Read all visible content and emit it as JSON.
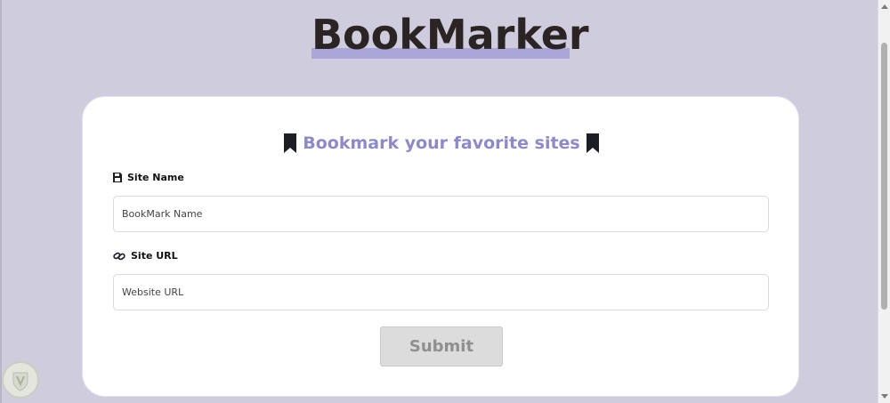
{
  "app": {
    "logo_text": "BookMarker"
  },
  "form": {
    "heading": "Bookmark your favorite sites",
    "site_name": {
      "label": "Site Name",
      "placeholder": "BookMark Name",
      "value": ""
    },
    "site_url": {
      "label": "Site URL",
      "placeholder": "Website URL",
      "value": ""
    },
    "submit_label": "Submit"
  },
  "icons": {
    "heading_left": "bookmark-icon",
    "heading_right": "bookmark-icon",
    "site_name": "floppy-disk-icon",
    "site_url": "link-icon"
  },
  "colors": {
    "background": "#cfcddd",
    "accent": "#8e8ac8",
    "logo_highlight": "#aaa6d8",
    "logo_text": "#2b2424",
    "card": "#ffffff",
    "submit_bg": "#dcdcdc",
    "submit_text": "#8f8f8f"
  }
}
